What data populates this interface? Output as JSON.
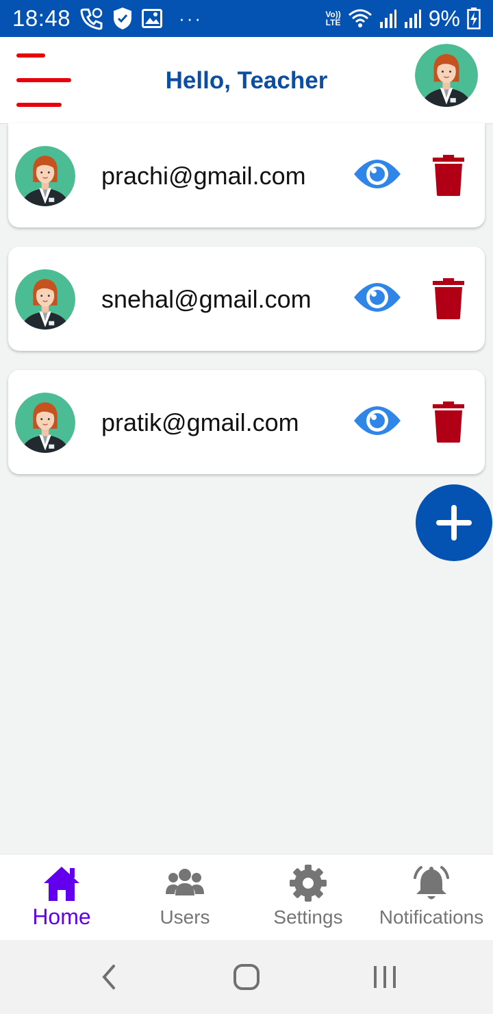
{
  "status_bar": {
    "time": "18:48",
    "network_label_top": "Vo))",
    "network_label_bottom": "LTE",
    "battery": "9%"
  },
  "header": {
    "title": "Hello, Teacher",
    "menu_icon": "hamburger-menu-icon",
    "menu_color": "#e8000b"
  },
  "users": [
    {
      "email": "prachi@gmail.com"
    },
    {
      "email": "snehal@gmail.com"
    },
    {
      "email": "pratik@gmail.com"
    }
  ],
  "fab": {
    "icon": "plus-icon",
    "color": "#0452b1"
  },
  "bottom_nav": {
    "items": [
      {
        "label": "Home",
        "icon": "home-icon",
        "active": true
      },
      {
        "label": "Users",
        "icon": "users-icon",
        "active": false
      },
      {
        "label": "Settings",
        "icon": "gear-icon",
        "active": false
      },
      {
        "label": "Notifications",
        "icon": "bell-icon",
        "active": false
      }
    ]
  },
  "colors": {
    "primary": "#0452b1",
    "active_nav": "#6200ee",
    "view_icon": "#2f86e8",
    "delete_icon": "#b10015"
  }
}
